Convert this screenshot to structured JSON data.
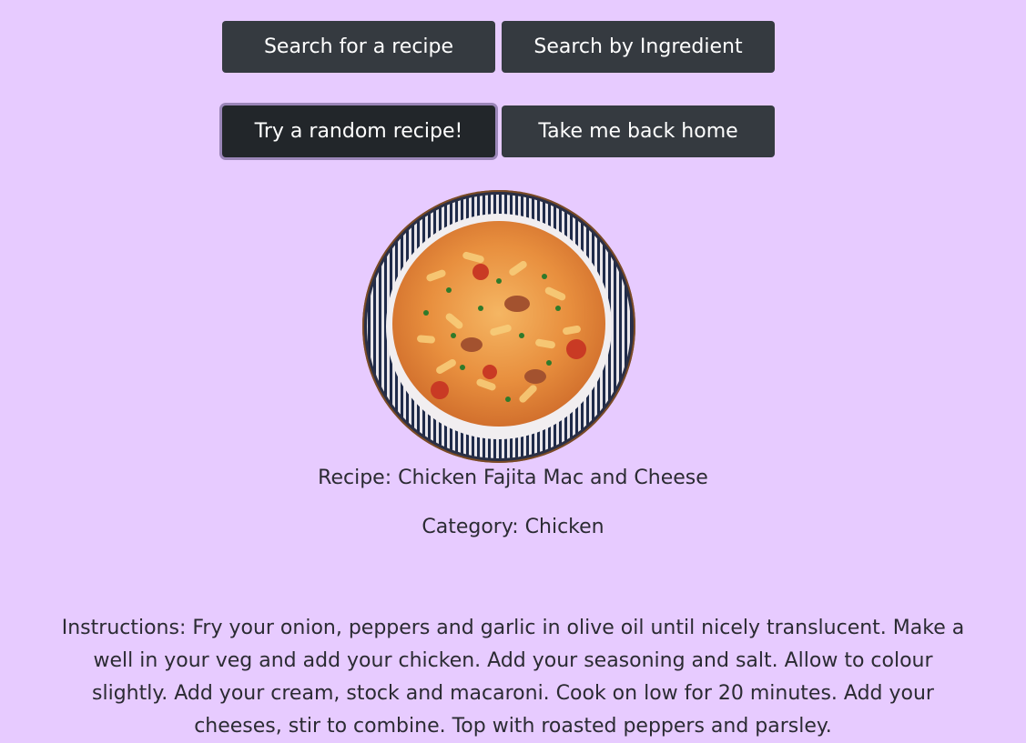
{
  "nav": {
    "search_recipe_label": "Search for a recipe",
    "search_ingredient_label": "Search by Ingredient",
    "random_label": "Try a random recipe!",
    "home_label": "Take me back home"
  },
  "recipe": {
    "image_alt": "Chicken Fajita Mac and Cheese",
    "name_line": "Recipe: Chicken Fajita Mac and Cheese",
    "category_line": "Category: Chicken",
    "instructions": "Instructions: Fry your onion, peppers and garlic in olive oil until nicely translucent. Make a well in your veg and add your chicken. Add your seasoning and salt. Allow to colour slightly. Add your cream, stock and macaroni. Cook on low for 20 minutes. Add your cheeses, stir to combine. Top with roasted peppers and parsley."
  },
  "colors": {
    "page_background": "#e7cbff",
    "button_background": "#353a40",
    "button_focused": "#22262a",
    "button_text": "#ffffff",
    "body_text": "#2b2b33"
  }
}
